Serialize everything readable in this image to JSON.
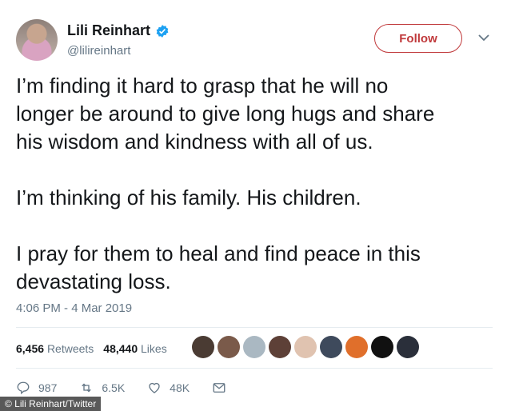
{
  "user": {
    "name": "Lili Reinhart",
    "handle": "@lilireinhart",
    "follow_label": "Follow"
  },
  "tweet": {
    "text": "I’m finding it hard to grasp that he will no\nlonger be around to give long hugs and share\nhis wisdom and kindness with all of us.\n\nI’m thinking of his family. His children.\n\nI pray for them to heal and find peace in this\ndevastating loss.",
    "timestamp": "4:06 PM - 4 Mar 2019"
  },
  "stats": {
    "retweets_count": "6,456",
    "retweets_label": "Retweets",
    "likes_count": "48,440",
    "likes_label": "Likes"
  },
  "actions": {
    "replies": "987",
    "retweets": "6.5K",
    "likes": "48K"
  },
  "credit": "© Lili Reinhart/Twitter",
  "colors": {
    "follow_accent": "#c0393b",
    "verified_blue": "#1da1f2",
    "muted_text": "#657786"
  }
}
